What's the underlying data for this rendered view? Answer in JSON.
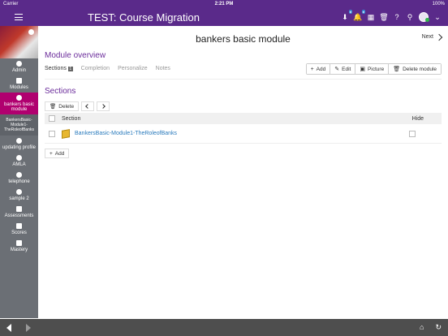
{
  "status": {
    "carrier": "Carrier",
    "time": "2:21 PM",
    "battery": "100%"
  },
  "header": {
    "title": "TEST: Course Migration"
  },
  "sidebar": {
    "items": [
      {
        "label": "Admin"
      },
      {
        "label": "Modules"
      },
      {
        "label": "bankers basic module",
        "active": true
      },
      {
        "label": "BankersBasic-Module1-TheRoleofBanks",
        "sub": true
      },
      {
        "label": "updating profile"
      },
      {
        "label": "AMLA"
      },
      {
        "label": "telephone"
      },
      {
        "label": "sample 2"
      },
      {
        "label": "Assessments"
      },
      {
        "label": "Scores"
      },
      {
        "label": "Mastery"
      }
    ]
  },
  "page": {
    "title": "bankers basic module",
    "next_label": "Next",
    "overview_heading": "Module overview",
    "tabs": [
      {
        "label": "Sections",
        "count": "1",
        "active": true
      },
      {
        "label": "Completion"
      },
      {
        "label": "Personalize"
      },
      {
        "label": "Notes"
      }
    ],
    "actions": [
      {
        "icon": "+",
        "label": "Add"
      },
      {
        "icon": "✎",
        "label": "Edit"
      },
      {
        "icon": "▣",
        "label": "Picture"
      },
      {
        "icon": "🗑",
        "label": "Delete module"
      }
    ],
    "sections_heading": "Sections",
    "delete_label": "Delete",
    "table": {
      "col_section": "Section",
      "col_hide": "Hide",
      "rows": [
        {
          "name": "BankersBasic-Module1-TheRoleofBanks"
        }
      ]
    },
    "add_label": "Add"
  }
}
